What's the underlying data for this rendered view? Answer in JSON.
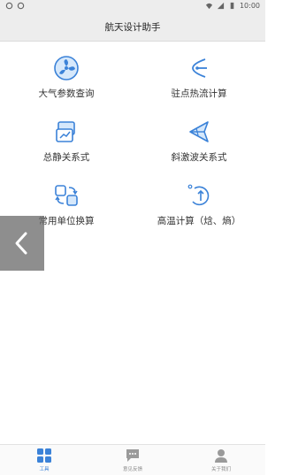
{
  "status": {
    "time": "10:00"
  },
  "header": {
    "title": "航天设计助手"
  },
  "tools": [
    {
      "label": "大气参数查询",
      "icon": "atmosphere-fan-icon"
    },
    {
      "label": "驻点热流计算",
      "icon": "stagnation-heat-icon"
    },
    {
      "label": "总静关系式",
      "icon": "total-static-icon"
    },
    {
      "label": "斜激波关系式",
      "icon": "oblique-shock-icon"
    },
    {
      "label": "常用单位换算",
      "icon": "unit-convert-icon"
    },
    {
      "label": "高温计算（焓、熵）",
      "icon": "high-temp-icon"
    }
  ],
  "tabs": [
    {
      "label": "工具",
      "icon": "grid-icon",
      "active": true
    },
    {
      "label": "意见反馈",
      "icon": "feedback-icon",
      "active": false
    },
    {
      "label": "关于我们",
      "icon": "user-icon",
      "active": false
    }
  ],
  "colors": {
    "accent": "#3b82d8",
    "bar_bg": "#ededed"
  }
}
